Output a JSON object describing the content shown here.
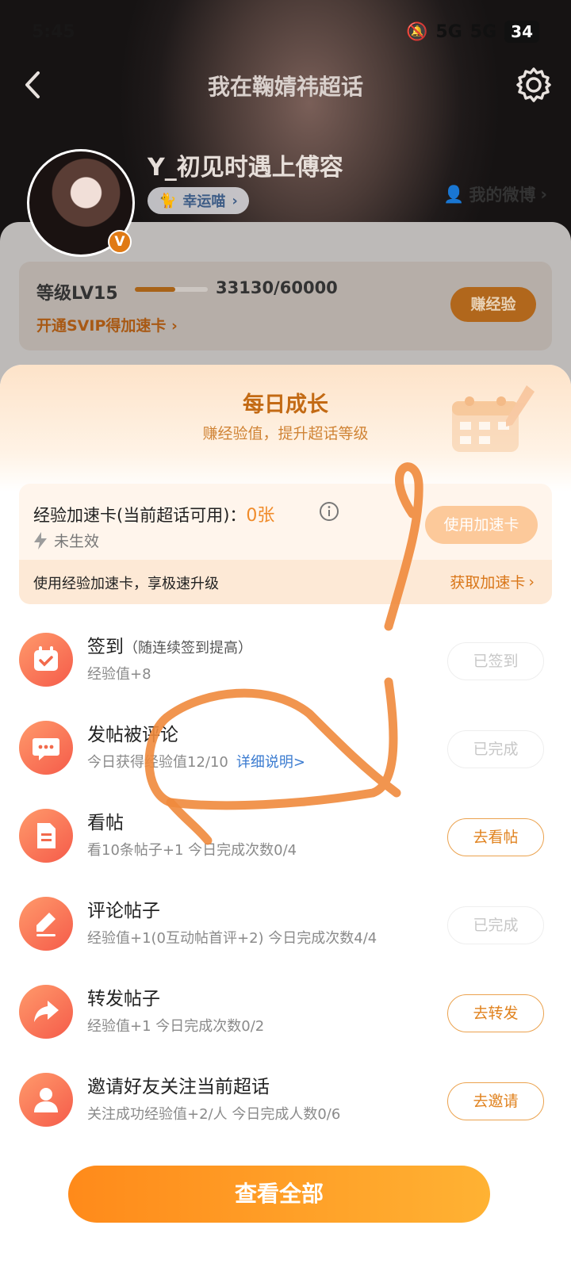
{
  "status_bar": {
    "time": "5:45",
    "network_1": "5G",
    "network_2": "5G",
    "battery": "34"
  },
  "nav": {
    "title": "我在鞠婧祎超话"
  },
  "profile": {
    "username": "Y_初见时遇上傅容",
    "tag": "幸运喵",
    "verified_badge": "V",
    "my_weibo": "我的微博"
  },
  "level": {
    "label": "等级LV15",
    "progress_current": 33130,
    "progress_max": 60000,
    "progress_text": "33130/60000",
    "svip_link": "开通SVIP得加速卡",
    "earn_button": "赚经验"
  },
  "sheet": {
    "title": "每日成长",
    "subtitle": "赚经验值，提升超话等级",
    "boost": {
      "title": "经验加速卡(当前超话可用)：",
      "count": "0张",
      "state": "未生效",
      "use_button": "使用加速卡",
      "note": "使用经验加速卡，享极速升级",
      "get_link": "获取加速卡"
    },
    "tasks": [
      {
        "name": "签到",
        "hint": "（随连续签到提高）",
        "desc": "经验值+8",
        "button": "已签到",
        "icon": "calendar-check-icon",
        "done": true
      },
      {
        "name": "发帖被评论",
        "hint": "",
        "desc": "今日获得经验值12/10",
        "link": "详细说明>",
        "button": "已完成",
        "icon": "chat-bubble-icon",
        "done": true
      },
      {
        "name": "看帖",
        "hint": "",
        "desc": "看10条帖子+1   今日完成次数0/4",
        "button": "去看帖",
        "icon": "document-icon",
        "done": false
      },
      {
        "name": "评论帖子",
        "hint": "",
        "desc": "经验值+1(0互动帖首评+2)   今日完成次数4/4",
        "button": "已完成",
        "icon": "pencil-icon",
        "done": true
      },
      {
        "name": "转发帖子",
        "hint": "",
        "desc": "经验值+1   今日完成次数0/2",
        "button": "去转发",
        "icon": "share-arrow-icon",
        "done": false
      },
      {
        "name": "邀请好友关注当前超话",
        "hint": "",
        "desc": "关注成功经验值+2/人   今日完成人数0/6",
        "button": "去邀请",
        "icon": "person-icon",
        "done": false
      }
    ],
    "view_all": "查看全部"
  },
  "colors": {
    "accent": "#f08b2a",
    "link_blue": "#3a7bd0",
    "scribble": "#f08a3c"
  }
}
